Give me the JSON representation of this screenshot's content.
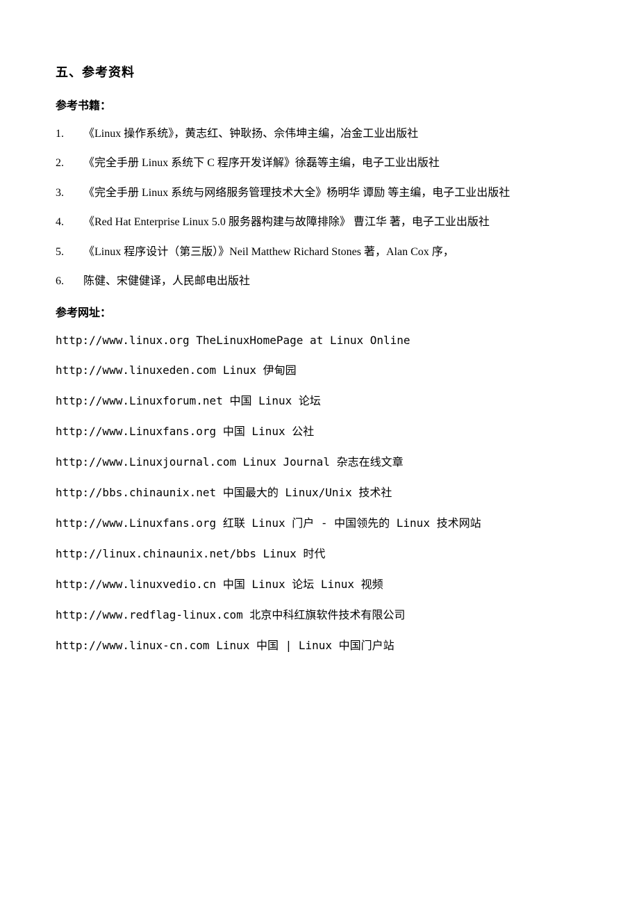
{
  "section_title": "五、参考资料",
  "subheading_books": "参考书籍：",
  "books": [
    {
      "num": "1.",
      "text": "《Linux 操作系统》，黄志红、钟耿扬、佘伟坤主编，冶金工业出版社"
    },
    {
      "num": "2.",
      "text": "《完全手册 Linux 系统下 C 程序开发详解》徐磊等主编，电子工业出版社"
    },
    {
      "num": "3.",
      "text": "《完全手册 Linux 系统与网络服务管理技术大全》杨明华 谭励 等主编，电子工业出版社"
    },
    {
      "num": "4.",
      "text": "《Red Hat Enterprise Linux 5.0 服务器构建与故障排除》 曹江华 著，电子工业出版社"
    },
    {
      "num": "5.",
      "text": "《Linux 程序设计（第三版）》Neil Matthew Richard Stones 著，Alan Cox 序，"
    },
    {
      "num": "6.",
      "text": "陈健、宋健健译，人民邮电出版社"
    }
  ],
  "subheading_urls": "参考网址：",
  "urls": [
    "http://www.linux.org TheLinuxHomePage at Linux Online",
    "http://www.linuxeden.com Linux 伊甸园",
    "http://www.Linuxforum.net 中国 Linux 论坛",
    "http://www.Linuxfans.org 中国 Linux 公社",
    "http://www.Linuxjournal.com Linux Journal 杂志在线文章",
    "http://bbs.chinaunix.net 中国最大的 Linux/Unix 技术社",
    "http://www.Linuxfans.org 红联 Linux 门户 - 中国领先的 Linux 技术网站",
    "http://linux.chinaunix.net/bbs Linux 时代",
    "http://www.linuxvedio.cn 中国 Linux 论坛 Linux 视频",
    "http://www.redflag-linux.com 北京中科红旗软件技术有限公司",
    "http://www.linux-cn.com Linux 中国 | Linux 中国门户站"
  ]
}
